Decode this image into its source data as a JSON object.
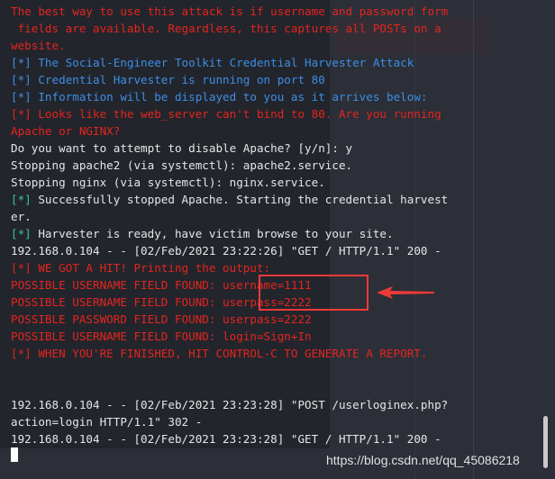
{
  "terminal": {
    "lines": [
      {
        "parts": [
          {
            "t": "The best way to use this attack is if username and password form",
            "c": "red"
          }
        ]
      },
      {
        "parts": [
          {
            "t": " fields are available. Regardless, this captures all POSTs on a",
            "c": "red"
          }
        ]
      },
      {
        "parts": [
          {
            "t": "website.",
            "c": "red"
          }
        ]
      },
      {
        "parts": [
          {
            "t": "[*] The Social-Engineer Toolkit Credential Harvester Attack",
            "c": "blue"
          }
        ]
      },
      {
        "parts": [
          {
            "t": "[*] Credential Harvester is running on port 80",
            "c": "blue"
          }
        ]
      },
      {
        "parts": [
          {
            "t": "[*] Information will be displayed to you as it arrives below:",
            "c": "blue"
          }
        ]
      },
      {
        "parts": [
          {
            "t": "[*] Looks like the web_server can't bind to 80. Are you running",
            "c": "red"
          }
        ]
      },
      {
        "parts": [
          {
            "t": "Apache or NGINX?",
            "c": "red"
          }
        ]
      },
      {
        "parts": [
          {
            "t": "Do you want to attempt to disable Apache? [y/n]: y",
            "c": "white"
          }
        ]
      },
      {
        "parts": [
          {
            "t": "Stopping apache2 (via systemctl): apache2.service.",
            "c": "white"
          }
        ]
      },
      {
        "parts": [
          {
            "t": "Stopping nginx (via systemctl): nginx.service.",
            "c": "white"
          }
        ]
      },
      {
        "parts": [
          {
            "t": "[*]",
            "c": "teal"
          },
          {
            "t": " Successfully stopped Apache. Starting the credential harvest",
            "c": "white"
          }
        ]
      },
      {
        "parts": [
          {
            "t": "er.",
            "c": "white"
          }
        ]
      },
      {
        "parts": [
          {
            "t": "[*]",
            "c": "teal"
          },
          {
            "t": " Harvester is ready, have victim browse to your site.",
            "c": "white"
          }
        ]
      },
      {
        "parts": [
          {
            "t": "192.168.0.104 - - [02/Feb/2021 23:22:26] \"GET / HTTP/1.1\" 200 -",
            "c": "white"
          }
        ]
      },
      {
        "parts": [
          {
            "t": "[*] WE GOT A HIT! Printing the output:",
            "c": "red"
          }
        ]
      },
      {
        "parts": [
          {
            "t": "POSSIBLE USERNAME FIELD FOUND: username=1111",
            "c": "red"
          }
        ]
      },
      {
        "parts": [
          {
            "t": "POSSIBLE USERNAME FIELD FOUND: userpass=2222",
            "c": "red"
          }
        ]
      },
      {
        "parts": [
          {
            "t": "POSSIBLE PASSWORD FIELD FOUND: userpass=2222",
            "c": "red"
          }
        ]
      },
      {
        "parts": [
          {
            "t": "POSSIBLE USERNAME FIELD FOUND: login=Sign+In",
            "c": "red"
          }
        ]
      },
      {
        "parts": [
          {
            "t": "[*] WHEN YOU'RE FINISHED, HIT CONTROL-C TO GENERATE A REPORT.",
            "c": "red"
          }
        ]
      },
      {
        "parts": []
      },
      {
        "parts": []
      },
      {
        "parts": [
          {
            "t": "192.168.0.104 - - [02/Feb/2021 23:23:28] \"POST /userloginex.php?",
            "c": "white"
          }
        ]
      },
      {
        "parts": [
          {
            "t": "action=login HTTP/1.1\" 302 -",
            "c": "white"
          }
        ]
      },
      {
        "parts": [
          {
            "t": "192.168.0.104 - - [02/Feb/2021 23:23:28] \"GET / HTTP/1.1\" 200 -",
            "c": "white"
          }
        ]
      }
    ]
  },
  "watermark": "https://blog.csdn.net/qq_45086218",
  "colors": {
    "red": "#e3251f",
    "blue": "#3c8ee6",
    "teal": "#3bc2a8",
    "highlight": "#f03a3a"
  }
}
